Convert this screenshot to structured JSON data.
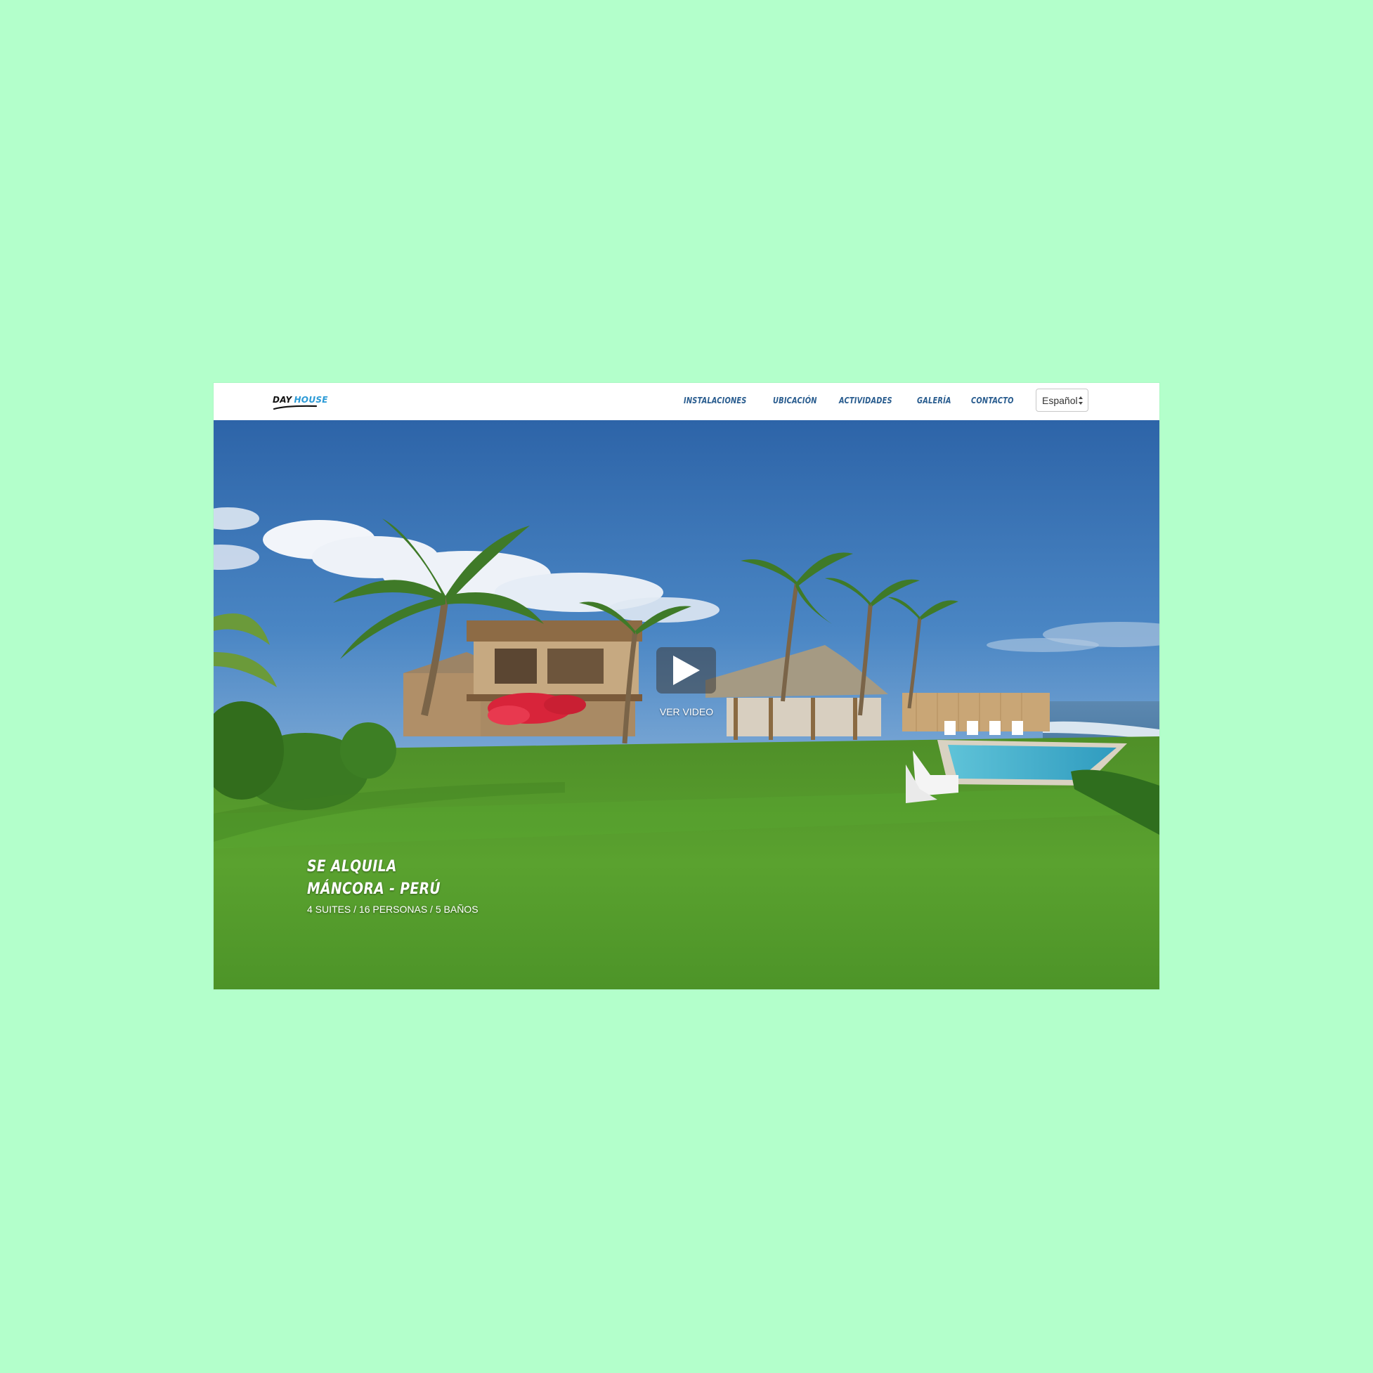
{
  "brand": {
    "word1": "DAY",
    "word2": "HOUSE"
  },
  "nav": {
    "links": [
      "INSTALACIONES",
      "UBICACIÓN",
      "ACTIVIDADES",
      "GALERÍA",
      "CONTACTO"
    ],
    "language": "Español"
  },
  "hero": {
    "video_label": "VER VIDEO",
    "title_line1": "SE ALQUILA",
    "title_line2": "MÁNCORA - PERÚ",
    "subtitle": "4 SUITES / 16 PERSONAS / 5 BAÑOS"
  },
  "colors": {
    "page_background": "#b3ffcb",
    "nav_link": "#2a5d8f",
    "brand_accent": "#2b9ad6",
    "sky": "#3a74b8",
    "lawn": "#4e9a2a"
  },
  "icons": {
    "play": "play-icon",
    "select_arrows": "updown-arrows-icon"
  }
}
